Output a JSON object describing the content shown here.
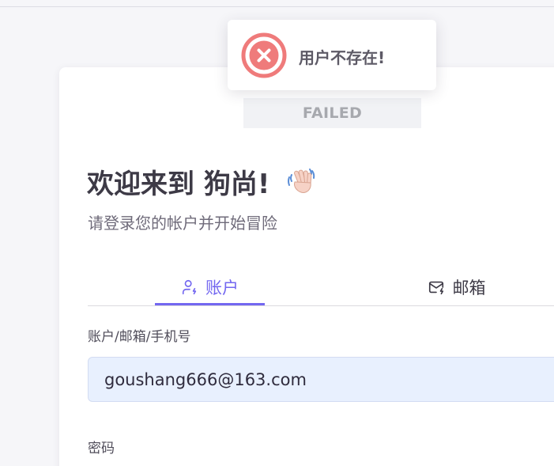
{
  "toast": {
    "message": "用户不存在!",
    "icon": "x-circle-icon",
    "color": "#ef7b7b"
  },
  "status": {
    "text": "FAILED"
  },
  "welcome": {
    "title": "欢迎来到 狗尚!",
    "subtitle": "请登录您的帐户并开始冒险",
    "icon": "waving-hand-icon"
  },
  "tabs": [
    {
      "label": "账户",
      "icon": "user-icon",
      "active": true
    },
    {
      "label": "邮箱",
      "icon": "mail-icon",
      "active": false
    }
  ],
  "form": {
    "account_label": "账户/邮箱/手机号",
    "account_value": "goushang666@163.com",
    "password_label": "密码"
  },
  "colors": {
    "accent": "#7367f0",
    "error": "#ef7b7b",
    "input_bg": "#e8f0fe"
  }
}
